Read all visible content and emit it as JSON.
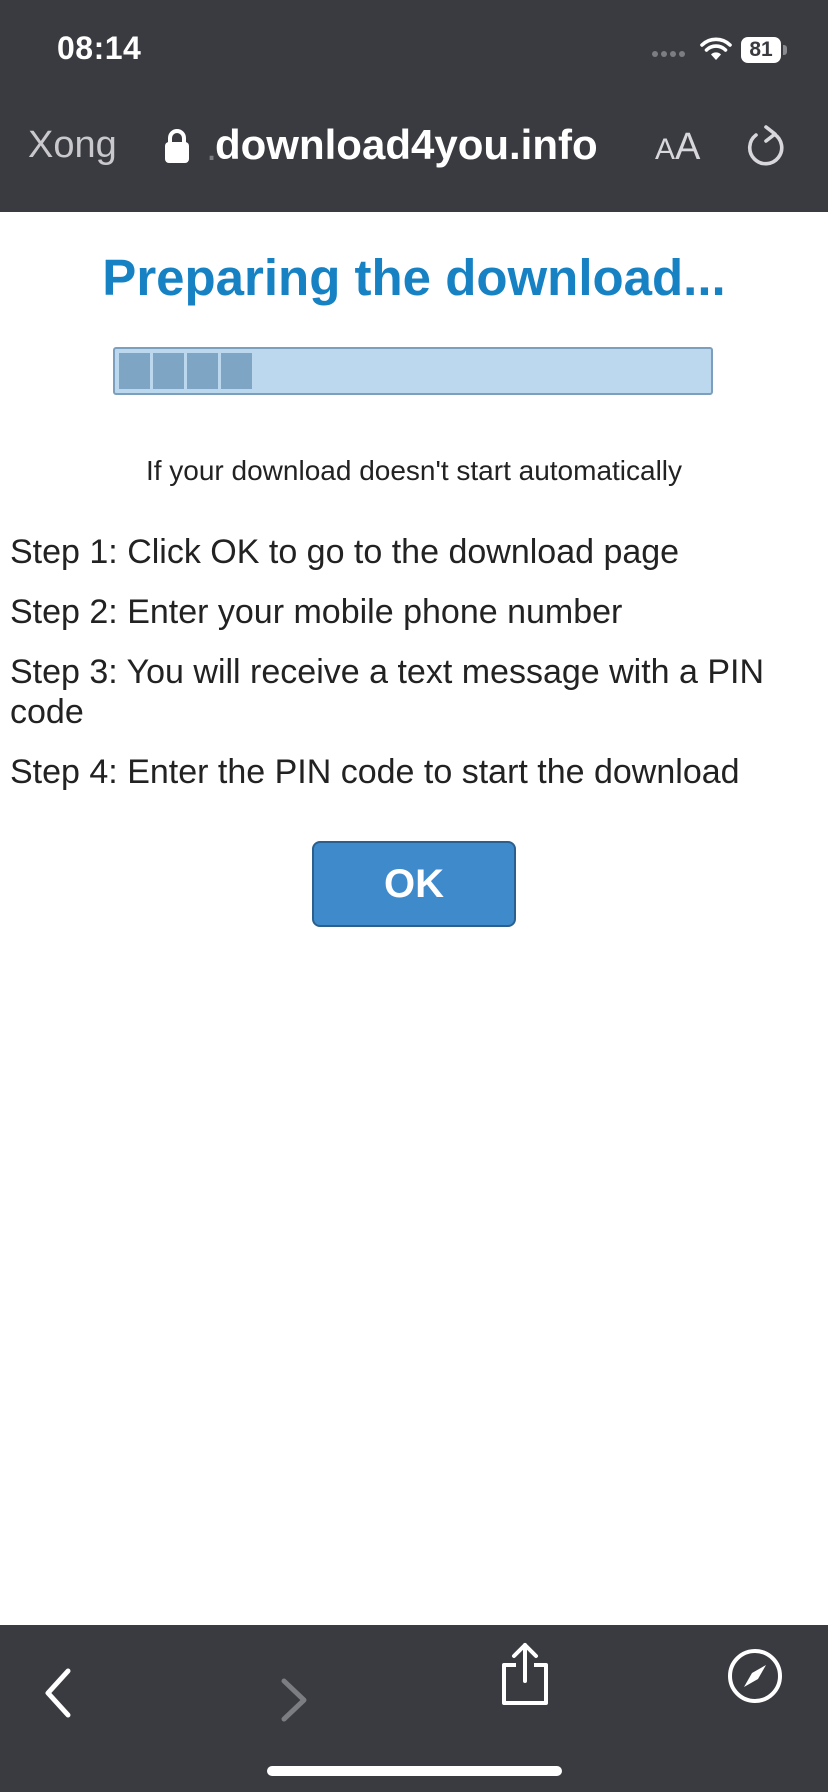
{
  "status_bar": {
    "time": "08:14",
    "battery_level": "81",
    "icons": [
      "signal-icon",
      "wifi-icon",
      "battery-icon"
    ]
  },
  "browser": {
    "done_label": "Xong",
    "url_prefix": ".",
    "url_domain": "download4you.info",
    "text_size_label_small": "A",
    "text_size_label_large": "A",
    "icons": [
      "lock-icon",
      "reload-icon"
    ]
  },
  "page": {
    "title": "Preparing the download...",
    "progress_segments": 4,
    "auto_note": "If your download doesn't start automatically",
    "steps": [
      "Step 1: Click OK to go to the download page",
      "Step 2: Enter your mobile phone number",
      "Step 3: You will receive a text message with a PIN code",
      "Step 4: Enter the PIN code to start the download"
    ],
    "ok_label": "OK"
  },
  "toolbar": {
    "icons": [
      "back-icon",
      "forward-icon",
      "share-icon",
      "compass-icon"
    ]
  },
  "colors": {
    "chrome_background": "#3a3b40",
    "title": "#1682c4",
    "button": "#3f8acb",
    "progress_track": "#bcd8ef",
    "progress_fill": "#7fa5c5"
  }
}
